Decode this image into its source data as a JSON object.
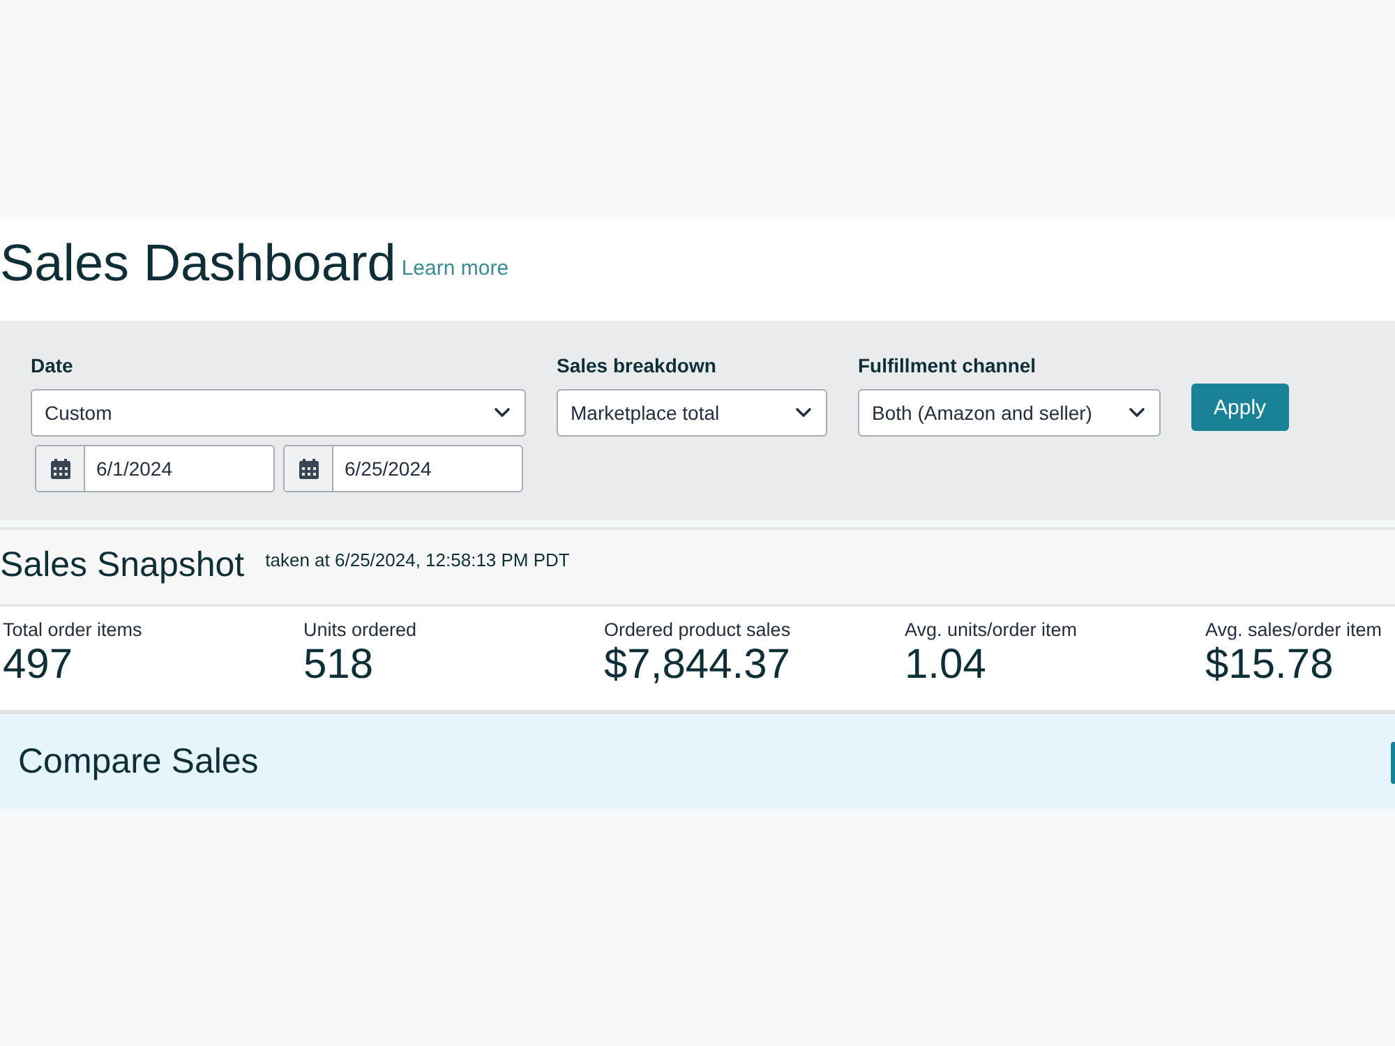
{
  "header": {
    "title": "Sales Dashboard",
    "learn_more_link": "Learn more"
  },
  "filters": {
    "fields": [
      {
        "kind": "date",
        "label": "Date",
        "value": "Custom",
        "start_date": "6/1/2024",
        "end_date": "6/25/2024"
      },
      {
        "kind": "select",
        "label": "Sales breakdown",
        "value": "Marketplace total"
      },
      {
        "kind": "select",
        "label": "Fulfillment channel",
        "value": "Both (Amazon and seller)"
      }
    ],
    "apply_button": "Apply"
  },
  "snapshot": {
    "title": "Sales Snapshot",
    "timestamp": "taken at 6/25/2024, 12:58:13 PM PDT",
    "metrics": [
      {
        "label": "Total order items",
        "value": "497"
      },
      {
        "label": "Units ordered",
        "value": "518"
      },
      {
        "label": "Ordered product sales",
        "value": "$7,844.37"
      },
      {
        "label": "Avg. units/order item",
        "value": "1.04"
      },
      {
        "label": "Avg. sales/order item",
        "value": "$15.78"
      }
    ]
  },
  "compare_sales": {
    "title": "Compare Sales"
  }
}
